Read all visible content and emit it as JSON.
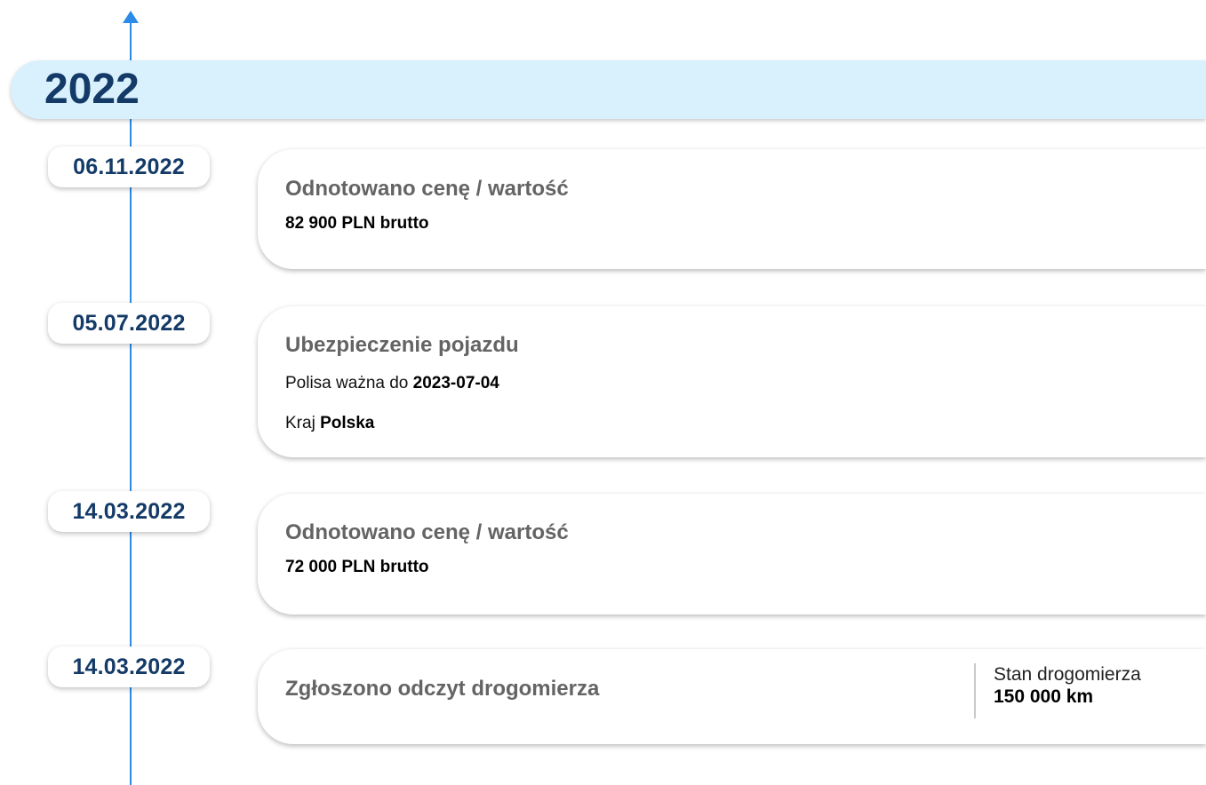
{
  "timeline": {
    "year": "2022",
    "events": [
      {
        "date": "06.11.2022",
        "title": "Odnotowano cenę / wartość",
        "value": "82 900 PLN brutto"
      },
      {
        "date": "05.07.2022",
        "title": "Ubezpieczenie pojazdu",
        "policy_label": "Polisa ważna do",
        "policy_value": "2023-07-04",
        "country_label": "Kraj",
        "country_value": "Polska"
      },
      {
        "date": "14.03.2022",
        "title": "Odnotowano cenę / wartość",
        "value": "72 000 PLN brutto"
      },
      {
        "date": "14.03.2022",
        "title": "Zgłoszono odczyt drogomierza",
        "stat_label": "Stan drogomierza",
        "stat_value": "150 000 km"
      }
    ]
  },
  "colors": {
    "accent": "#2b8be6",
    "year_band": "#d9f0fd",
    "heading": "#143a67",
    "card_title": "#646464"
  },
  "icons": {
    "axis_head": "arrow-up-icon"
  }
}
